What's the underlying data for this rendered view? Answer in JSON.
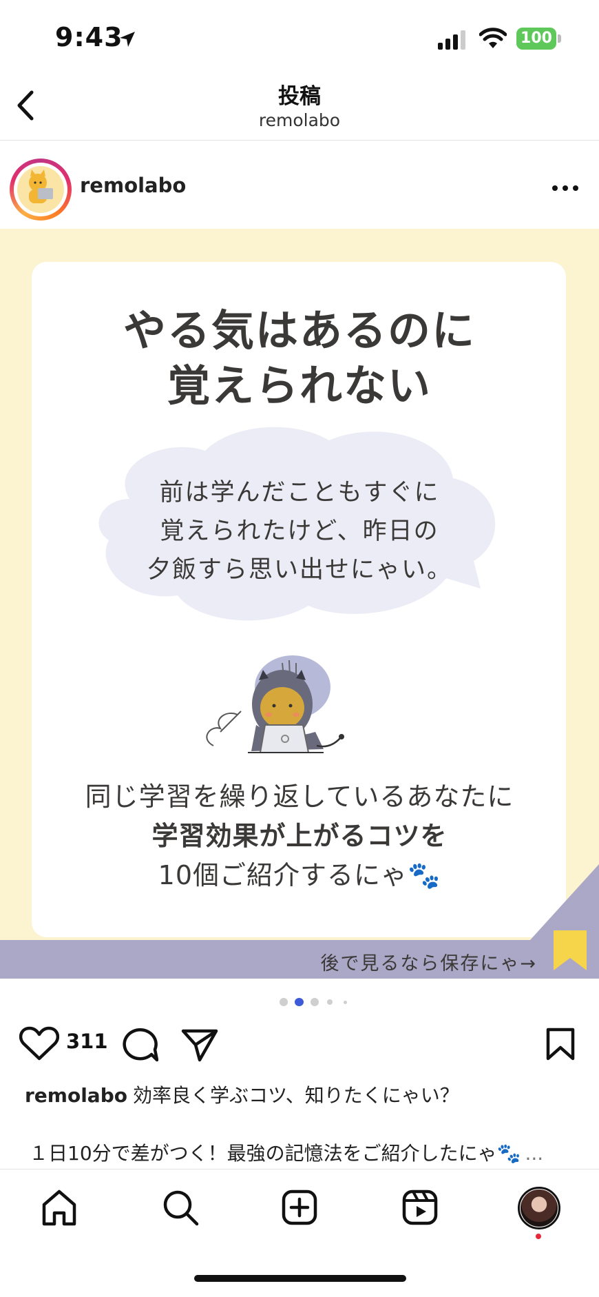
{
  "status_bar": {
    "time": "9:43",
    "battery": "100"
  },
  "nav": {
    "title": "投稿",
    "subtitle": "remolabo"
  },
  "post": {
    "username": "remolabo",
    "image": {
      "heading_line1": "やる気はあるのに",
      "heading_line2": "覚えられない",
      "bubble_line1": "前は学んだこともすぐに",
      "bubble_line2": "覚えられたけど、昨日の",
      "bubble_line3": "夕飯すら思い出せにゃい。",
      "body_line1": "同じ学習を繰り返しているあなたに",
      "body_line2": "学習効果が上がるコツを",
      "body_line3": "10個ご紹介するにゃ🐾",
      "banner_text": "後で見るなら保存にゃ→"
    },
    "carousel": {
      "current": 2,
      "total": 5
    },
    "likes": "311",
    "caption_username": "remolabo",
    "caption_text": "効率良く学ぶコツ、知りたくにゃい？",
    "caption_line2": "１日10分で差がつく！最強の記憶法をご紹介したにゃ🐾",
    "caption_more": "..."
  },
  "tab_bar": {
    "items": [
      {
        "icon": "home-icon"
      },
      {
        "icon": "search-icon"
      },
      {
        "icon": "create-icon"
      },
      {
        "icon": "reels-icon"
      },
      {
        "icon": "profile-avatar"
      }
    ]
  },
  "colors": {
    "image_background": "#fcf3d1",
    "banner": "#aba7c6",
    "cloud": "#ececf6",
    "active_dot": "#3d5bd9",
    "battery": "#5fc85a",
    "notification": "#e8283b"
  }
}
